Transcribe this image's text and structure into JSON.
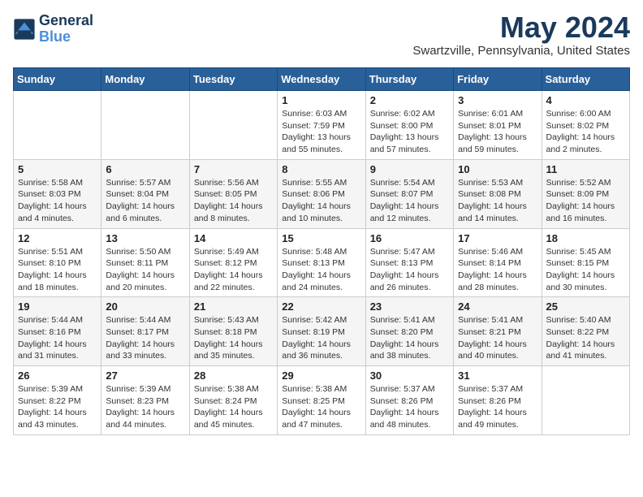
{
  "logo": {
    "line1": "General",
    "line2": "Blue"
  },
  "title": "May 2024",
  "location": "Swartzville, Pennsylvania, United States",
  "headers": [
    "Sunday",
    "Monday",
    "Tuesday",
    "Wednesday",
    "Thursday",
    "Friday",
    "Saturday"
  ],
  "weeks": [
    [
      {
        "day": "",
        "info": ""
      },
      {
        "day": "",
        "info": ""
      },
      {
        "day": "",
        "info": ""
      },
      {
        "day": "1",
        "info": "Sunrise: 6:03 AM\nSunset: 7:59 PM\nDaylight: 13 hours\nand 55 minutes."
      },
      {
        "day": "2",
        "info": "Sunrise: 6:02 AM\nSunset: 8:00 PM\nDaylight: 13 hours\nand 57 minutes."
      },
      {
        "day": "3",
        "info": "Sunrise: 6:01 AM\nSunset: 8:01 PM\nDaylight: 13 hours\nand 59 minutes."
      },
      {
        "day": "4",
        "info": "Sunrise: 6:00 AM\nSunset: 8:02 PM\nDaylight: 14 hours\nand 2 minutes."
      }
    ],
    [
      {
        "day": "5",
        "info": "Sunrise: 5:58 AM\nSunset: 8:03 PM\nDaylight: 14 hours\nand 4 minutes."
      },
      {
        "day": "6",
        "info": "Sunrise: 5:57 AM\nSunset: 8:04 PM\nDaylight: 14 hours\nand 6 minutes."
      },
      {
        "day": "7",
        "info": "Sunrise: 5:56 AM\nSunset: 8:05 PM\nDaylight: 14 hours\nand 8 minutes."
      },
      {
        "day": "8",
        "info": "Sunrise: 5:55 AM\nSunset: 8:06 PM\nDaylight: 14 hours\nand 10 minutes."
      },
      {
        "day": "9",
        "info": "Sunrise: 5:54 AM\nSunset: 8:07 PM\nDaylight: 14 hours\nand 12 minutes."
      },
      {
        "day": "10",
        "info": "Sunrise: 5:53 AM\nSunset: 8:08 PM\nDaylight: 14 hours\nand 14 minutes."
      },
      {
        "day": "11",
        "info": "Sunrise: 5:52 AM\nSunset: 8:09 PM\nDaylight: 14 hours\nand 16 minutes."
      }
    ],
    [
      {
        "day": "12",
        "info": "Sunrise: 5:51 AM\nSunset: 8:10 PM\nDaylight: 14 hours\nand 18 minutes."
      },
      {
        "day": "13",
        "info": "Sunrise: 5:50 AM\nSunset: 8:11 PM\nDaylight: 14 hours\nand 20 minutes."
      },
      {
        "day": "14",
        "info": "Sunrise: 5:49 AM\nSunset: 8:12 PM\nDaylight: 14 hours\nand 22 minutes."
      },
      {
        "day": "15",
        "info": "Sunrise: 5:48 AM\nSunset: 8:13 PM\nDaylight: 14 hours\nand 24 minutes."
      },
      {
        "day": "16",
        "info": "Sunrise: 5:47 AM\nSunset: 8:13 PM\nDaylight: 14 hours\nand 26 minutes."
      },
      {
        "day": "17",
        "info": "Sunrise: 5:46 AM\nSunset: 8:14 PM\nDaylight: 14 hours\nand 28 minutes."
      },
      {
        "day": "18",
        "info": "Sunrise: 5:45 AM\nSunset: 8:15 PM\nDaylight: 14 hours\nand 30 minutes."
      }
    ],
    [
      {
        "day": "19",
        "info": "Sunrise: 5:44 AM\nSunset: 8:16 PM\nDaylight: 14 hours\nand 31 minutes."
      },
      {
        "day": "20",
        "info": "Sunrise: 5:44 AM\nSunset: 8:17 PM\nDaylight: 14 hours\nand 33 minutes."
      },
      {
        "day": "21",
        "info": "Sunrise: 5:43 AM\nSunset: 8:18 PM\nDaylight: 14 hours\nand 35 minutes."
      },
      {
        "day": "22",
        "info": "Sunrise: 5:42 AM\nSunset: 8:19 PM\nDaylight: 14 hours\nand 36 minutes."
      },
      {
        "day": "23",
        "info": "Sunrise: 5:41 AM\nSunset: 8:20 PM\nDaylight: 14 hours\nand 38 minutes."
      },
      {
        "day": "24",
        "info": "Sunrise: 5:41 AM\nSunset: 8:21 PM\nDaylight: 14 hours\nand 40 minutes."
      },
      {
        "day": "25",
        "info": "Sunrise: 5:40 AM\nSunset: 8:22 PM\nDaylight: 14 hours\nand 41 minutes."
      }
    ],
    [
      {
        "day": "26",
        "info": "Sunrise: 5:39 AM\nSunset: 8:22 PM\nDaylight: 14 hours\nand 43 minutes."
      },
      {
        "day": "27",
        "info": "Sunrise: 5:39 AM\nSunset: 8:23 PM\nDaylight: 14 hours\nand 44 minutes."
      },
      {
        "day": "28",
        "info": "Sunrise: 5:38 AM\nSunset: 8:24 PM\nDaylight: 14 hours\nand 45 minutes."
      },
      {
        "day": "29",
        "info": "Sunrise: 5:38 AM\nSunset: 8:25 PM\nDaylight: 14 hours\nand 47 minutes."
      },
      {
        "day": "30",
        "info": "Sunrise: 5:37 AM\nSunset: 8:26 PM\nDaylight: 14 hours\nand 48 minutes."
      },
      {
        "day": "31",
        "info": "Sunrise: 5:37 AM\nSunset: 8:26 PM\nDaylight: 14 hours\nand 49 minutes."
      },
      {
        "day": "",
        "info": ""
      }
    ]
  ]
}
